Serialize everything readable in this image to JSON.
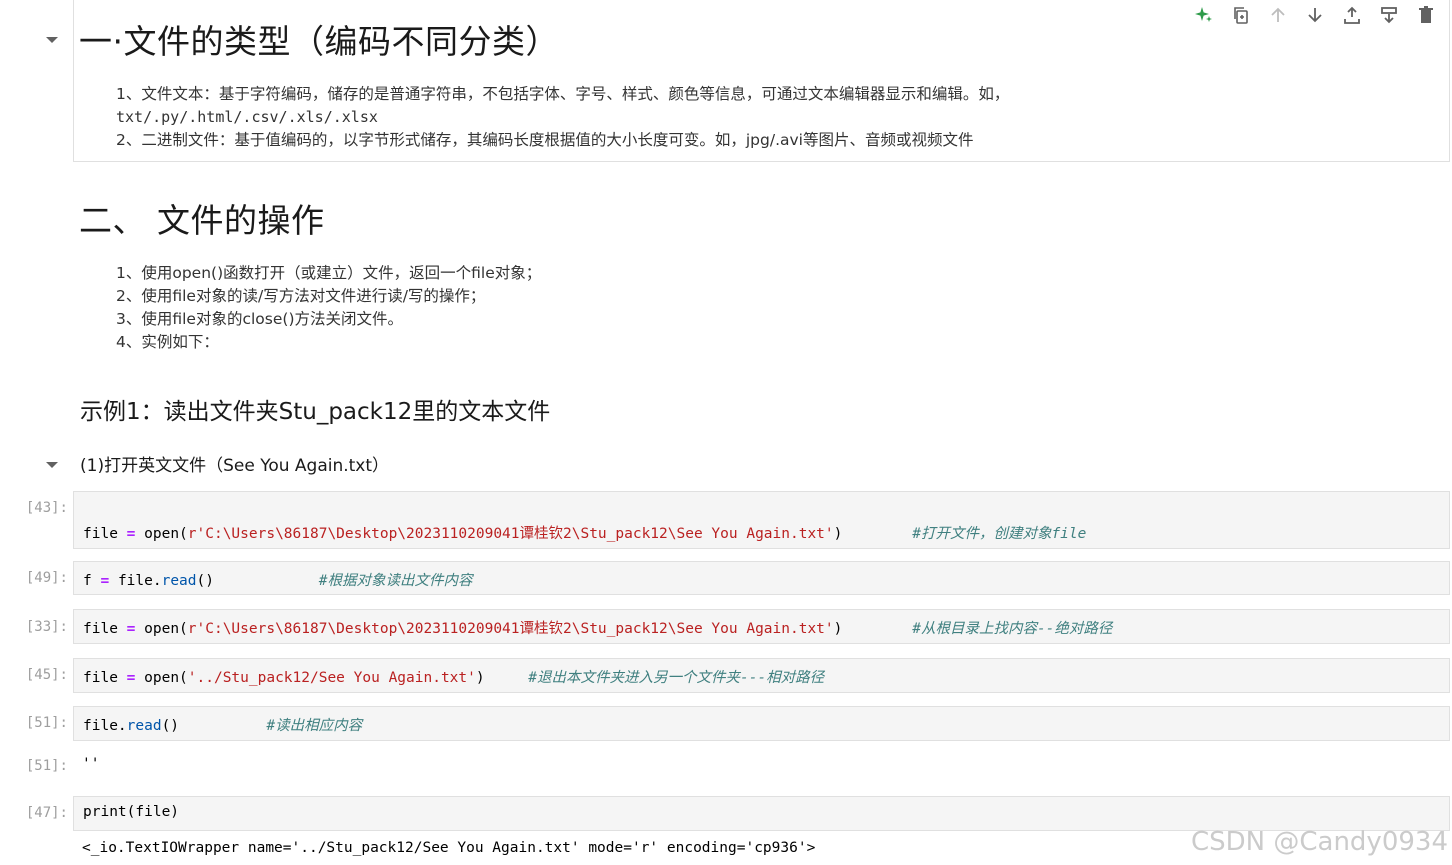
{
  "toolbar": {
    "icons": [
      "sparkle-icon",
      "duplicate-icon",
      "move-up-icon",
      "move-down-icon",
      "insert-above-icon",
      "insert-below-icon",
      "delete-icon"
    ]
  },
  "cell1": {
    "title": "一·文件的类型（编码不同分类）",
    "p1a": "1、文件文本：基于字符编码，储存的是普通字符串，不包括字体、字号、样式、颜色等信息，可通过文本编辑器显示和编辑。如，",
    "p1b": "txt/.py/.html/.csv/.xls/.xlsx",
    "p2": "2、二进制文件：基于值编码的，以字节形式储存，其编码长度根据值的大小长度可变。如，jpg/.avi等图片、音频或视频文件"
  },
  "cell2": {
    "title": "二、 文件的操作",
    "items": [
      "1、使用open()函数打开（或建立）文件，返回一个file对象；",
      "2、使用file对象的读/写方法对文件进行读/写的操作；",
      "3、使用file对象的close()方法关闭文件。",
      "4、实例如下："
    ],
    "example_title": "示例1：读出文件夹Stu_pack12里的文本文件"
  },
  "cell3": {
    "title": "(1)打开英文文件（See You Again.txt）"
  },
  "code_cells": [
    {
      "prompt": "[43]:",
      "tokens": [
        "file",
        " = ",
        "open(",
        "r'C:\\Users\\86187\\Desktop\\2023110209041谭桂钦2\\Stu_pack12\\See You Again.txt'",
        ")",
        "        ",
        "#打开文件，创建对象file"
      ]
    },
    {
      "prompt": "[49]:",
      "tokens": [
        "f",
        " = ",
        "file.",
        "read",
        "()",
        "            ",
        "#根据对象读出文件内容"
      ]
    },
    {
      "prompt": "[33]:",
      "tokens": [
        "file",
        " = ",
        "open(",
        "r'C:\\Users\\86187\\Desktop\\2023110209041谭桂钦2\\Stu_pack12\\See You Again.txt'",
        ")",
        "        ",
        "#从根目录上找内容--绝对路径"
      ]
    },
    {
      "prompt": "[45]:",
      "tokens": [
        "file",
        " = ",
        "open(",
        "'../Stu_pack12/See You Again.txt'",
        ")",
        "     ",
        "#退出本文件夹进入另一个文件夹---相对路径"
      ]
    },
    {
      "prompt": "[51]:",
      "tokens": [
        "file.",
        "read",
        "()",
        "          ",
        "#读出相应内容"
      ]
    },
    {
      "prompt": "[47]:",
      "tokens": [
        "print(file)"
      ]
    }
  ],
  "outputs": [
    {
      "prompt": "[51]:",
      "text": "''"
    },
    {
      "text": "<_io.TextIOWrapper name='../Stu_pack12/See You Again.txt' mode='r' encoding='cp936'>"
    }
  ],
  "watermark": "CSDN @Candy0934"
}
